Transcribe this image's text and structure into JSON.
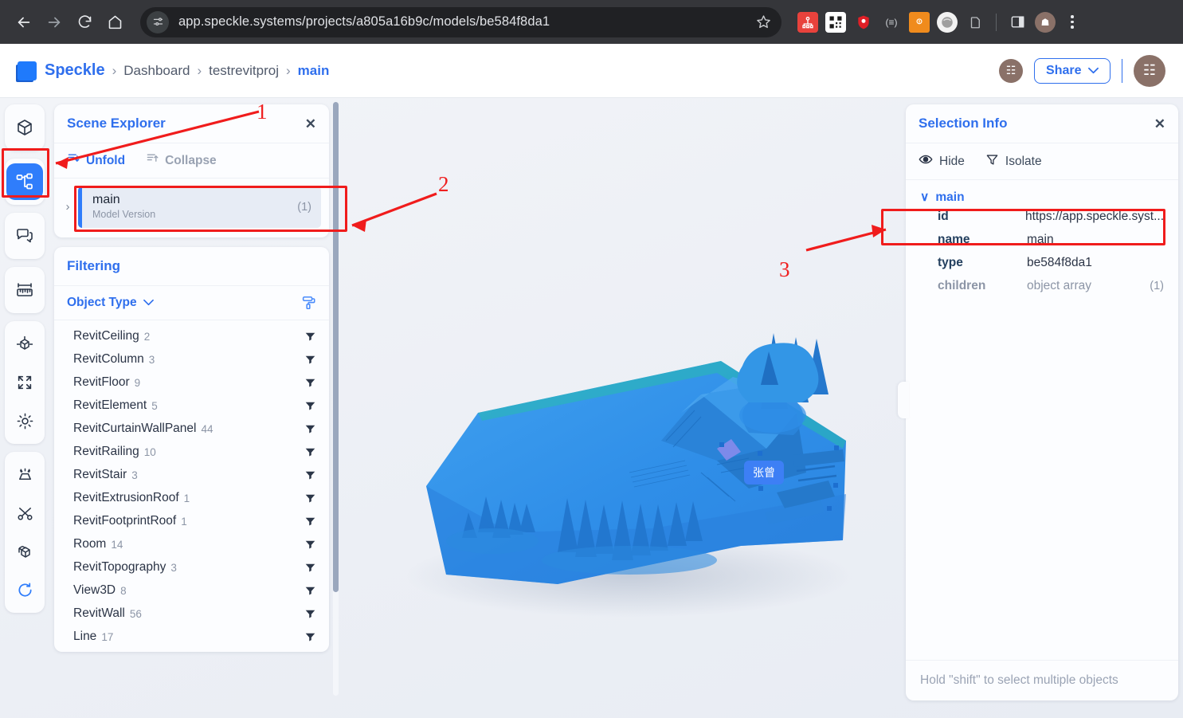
{
  "browser": {
    "url": "app.speckle.systems/projects/a805a16b9c/models/be584f8da1",
    "back_icon": "back-arrow-icon",
    "forward_icon": "forward-arrow-icon",
    "reload_icon": "reload-icon",
    "home_icon": "home-icon",
    "site_info_icon": "site-settings-icon",
    "bookmark_icon": "star-icon",
    "extensions": [
      "org-chart-extension-icon",
      "qr-code-extension-icon",
      "shield-extension-icon",
      "brackets-extension-icon",
      "orange-badge-extension-icon",
      "grey-sphere-extension-icon",
      "clipboard-extension-icon"
    ],
    "sidebar_icon": "side-panel-icon",
    "profile_icon": "profile-avatar",
    "menu_icon": "kebab-menu-icon"
  },
  "header": {
    "brand": "Speckle",
    "separator": "›",
    "breadcrumbs": [
      {
        "label": "Dashboard",
        "active": false
      },
      {
        "label": "testrevitproj",
        "active": false
      },
      {
        "label": "main",
        "active": true
      }
    ],
    "share_label": "Share",
    "share_caret": "∨",
    "avatar_glyph": "☷",
    "accent_color": "#2f6fed",
    "avatar_color": "#8a7168"
  },
  "rail": {
    "items": [
      {
        "name": "models-icon",
        "active": false
      },
      {
        "name": "scene-explorer-icon",
        "active": true
      },
      {
        "name": "comments-icon",
        "active": false
      },
      {
        "name": "measure-icon",
        "active": false
      },
      {
        "name": "section-box-icon",
        "active": false
      },
      {
        "name": "fit-to-screen-icon",
        "active": false
      },
      {
        "name": "sun-lighting-icon",
        "active": false
      },
      {
        "name": "explode-icon",
        "active": false
      },
      {
        "name": "scissors-cut-icon",
        "active": false
      },
      {
        "name": "views-cube-icon",
        "active": false
      },
      {
        "name": "reset-view-icon",
        "active": false
      }
    ]
  },
  "scene_explorer": {
    "title": "Scene Explorer",
    "close_glyph": "✕",
    "unfold_label": "Unfold",
    "collapse_label": "Collapse",
    "tree": [
      {
        "caret": "›",
        "name": "main",
        "subtitle": "Model Version",
        "count": "(1)"
      }
    ]
  },
  "filtering": {
    "title": "Filtering",
    "object_type_label": "Object Type",
    "chevron": "∨",
    "paint_icon": "paint-roller-icon",
    "items": [
      {
        "label": "RevitCeiling",
        "count": "2"
      },
      {
        "label": "RevitColumn",
        "count": "3"
      },
      {
        "label": "RevitFloor",
        "count": "9"
      },
      {
        "label": "RevitElement",
        "count": "5"
      },
      {
        "label": "RevitCurtainWallPanel",
        "count": "44"
      },
      {
        "label": "RevitRailing",
        "count": "10"
      },
      {
        "label": "RevitStair",
        "count": "3"
      },
      {
        "label": "RevitExtrusionRoof",
        "count": "1"
      },
      {
        "label": "RevitFootprintRoof",
        "count": "1"
      },
      {
        "label": "Room",
        "count": "14"
      },
      {
        "label": "RevitTopography",
        "count": "3"
      },
      {
        "label": "View3D",
        "count": "8"
      },
      {
        "label": "RevitWall",
        "count": "56"
      },
      {
        "label": "Line",
        "count": "17"
      }
    ]
  },
  "selection_info": {
    "title": "Selection Info",
    "close_glyph": "✕",
    "hide_label": "Hide",
    "isolate_label": "Isolate",
    "root_caret": "∨",
    "root_label": "main",
    "properties": [
      {
        "key": "id",
        "value": "https://app.speckle.syst...",
        "extra": "",
        "dim": false
      },
      {
        "key": "name",
        "value": "main",
        "extra": "",
        "dim": false
      },
      {
        "key": "type",
        "value": "be584f8da1",
        "extra": "",
        "dim": false
      },
      {
        "key": "children",
        "value": "object array",
        "extra": "(1)",
        "dim": true
      }
    ],
    "footer_hint": "Hold \"shift\" to select multiple objects"
  },
  "viewport": {
    "name_badge": "张曾",
    "model_color": "#2f8ee8"
  },
  "annotations": [
    {
      "number": "1"
    },
    {
      "number": "2"
    },
    {
      "number": "3"
    }
  ]
}
